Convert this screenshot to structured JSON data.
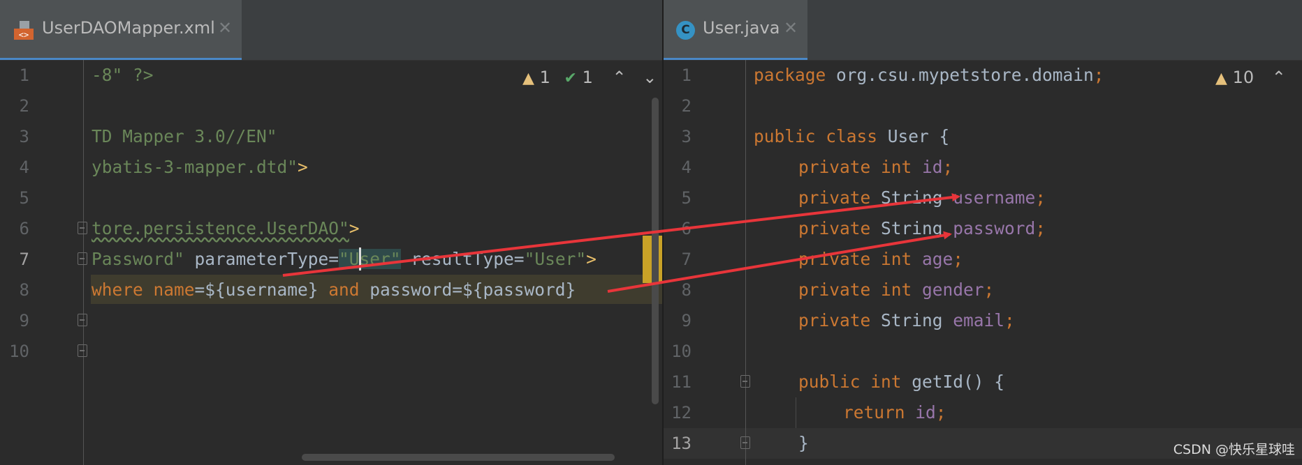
{
  "left_editor": {
    "tab": {
      "label": "UserDAOMapper.xml",
      "icon": "xml-file-icon"
    },
    "inspection": {
      "warnings": "1",
      "weak_warnings": "1"
    },
    "line_numbers": [
      "1",
      "2",
      "3",
      "4",
      "5",
      "6",
      "7",
      "8",
      "9",
      "10"
    ],
    "lines": {
      "l1a": "-8\" ?>",
      "l3a": "TD Mapper 3.0//EN\"",
      "l4a": "ybatis-3-mapper.dtd\"",
      "l4b": ">",
      "l6a": "tore.persistence.UserDAO\"",
      "l6b": ">",
      "l7a": "Password\"",
      "l7b": " parameterType=",
      "l7c": "\"User\"",
      "l7d": " resultType=",
      "l7e": "\"User\"",
      "l7f": ">",
      "l8a": "where name",
      "l8b": "=${username} ",
      "l8c": "and",
      "l8d": " password=${password}"
    }
  },
  "right_editor": {
    "tab": {
      "label": "User.java",
      "icon": "java-class-icon",
      "icon_letter": "C"
    },
    "inspection": {
      "warnings": "10"
    },
    "line_numbers": [
      "1",
      "2",
      "3",
      "4",
      "5",
      "6",
      "7",
      "8",
      "9",
      "10",
      "11",
      "12",
      "13"
    ],
    "lines": {
      "r1a": "package",
      "r1b": " org.csu.mypetstore.domain",
      "r1c": ";",
      "r3a": "public class",
      "r3b": " User {",
      "r4a": "private int",
      "r4b": " id",
      "r4c": ";",
      "r5a": "private",
      "r5b": " String ",
      "r5c": "username",
      "r5d": ";",
      "r6a": "private",
      "r6b": " String ",
      "r6c": "password",
      "r6d": ";",
      "r7a": "private int",
      "r7b": " age",
      "r7c": ";",
      "r8a": "private int",
      "r8b": " gender",
      "r8c": ";",
      "r9a": "private",
      "r9b": " String ",
      "r9c": "email",
      "r9d": ";",
      "r11a": "public int",
      "r11b": " getId() {",
      "r12a": "return",
      "r12b": " id",
      "r12c": ";",
      "r13a": "}"
    }
  },
  "watermark": "CSDN @快乐星球哇",
  "colors": {
    "editor_bg": "#2b2b2b",
    "tab_active_bg": "#4e5254",
    "keyword": "#cc7832",
    "string": "#6a8759",
    "field": "#9876aa",
    "text": "#a9b7c6",
    "arrow": "#e8353a"
  }
}
